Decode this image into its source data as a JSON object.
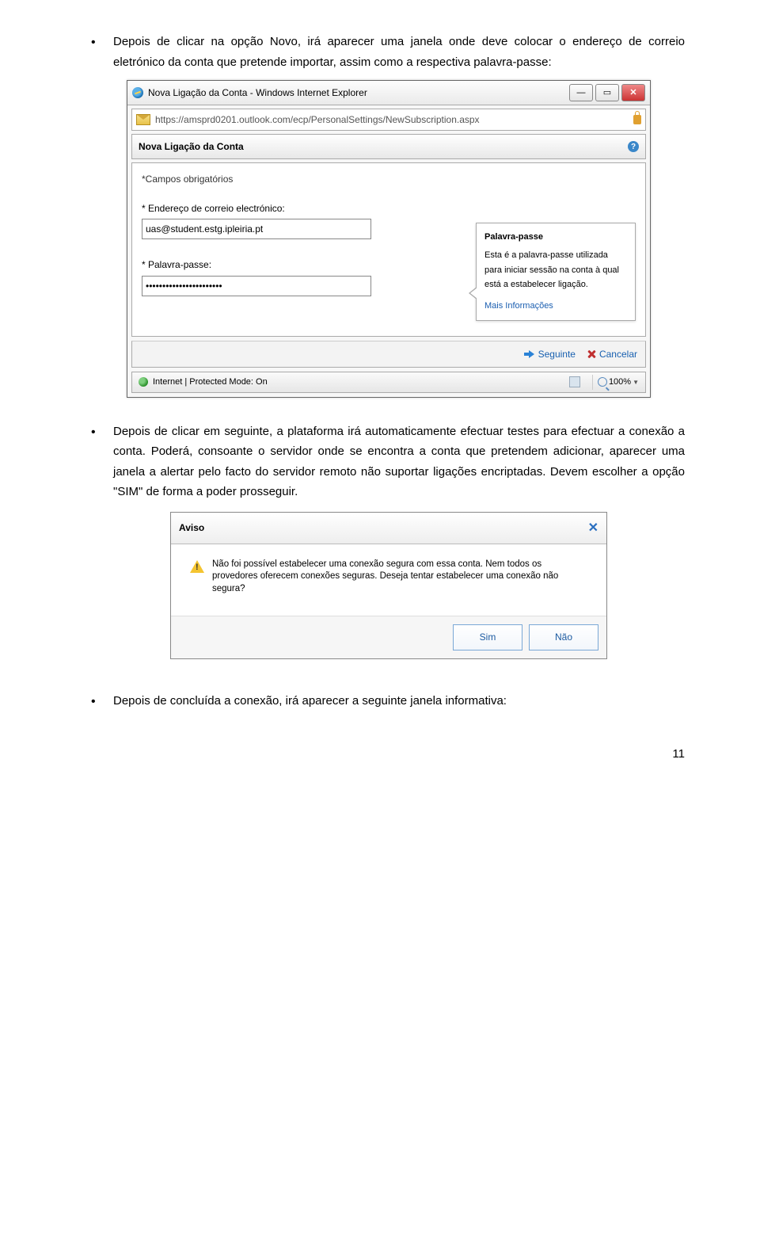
{
  "para1": "Depois de clicar na opção Novo, irá aparecer uma janela onde deve colocar o endereço de correio eletrónico da conta que pretende importar, assim como a respectiva palavra-passe:",
  "win1": {
    "title": "Nova Ligação da Conta - Windows Internet Explorer",
    "url": "https://amsprd0201.outlook.com/ecp/PersonalSettings/NewSubscription.aspx",
    "section_title": "Nova Ligação da Conta",
    "required_note": "*Campos obrigatórios",
    "email_label": "* Endereço de correio electrónico:",
    "email_value": "uas@student.estg.ipleiria.pt",
    "password_label": "* Palavra-passe:",
    "password_value": "•••••••••••••••••••••••",
    "tooltip_title": "Palavra-passe",
    "tooltip_body": "Esta é a palavra-passe utilizada para iniciar sessão na conta à qual está a estabelecer ligação.",
    "tooltip_link": "Mais Informações",
    "next_btn": "Seguinte",
    "cancel_btn": "Cancelar",
    "status_text": "Internet | Protected Mode: On",
    "zoom_text": "100%"
  },
  "para2": "Depois de clicar em seguinte, a plataforma irá automaticamente efectuar testes para efectuar a conexão a conta. Poderá, consoante o servidor onde se encontra a conta que pretendem adicionar, aparecer uma janela a alertar pelo facto do servidor remoto não suportar ligações encriptadas. Devem escolher a opção \"SIM\" de forma a poder prosseguir.",
  "win2": {
    "title": "Aviso",
    "body": "Não foi possível estabelecer uma conexão segura com essa conta. Nem todos os provedores oferecem conexões seguras. Deseja tentar estabelecer uma conexão não segura?",
    "yes_btn": "Sim",
    "no_btn": "Não"
  },
  "para3": "Depois de concluída a conexão, irá aparecer a seguinte janela informativa:",
  "page_number": "11"
}
